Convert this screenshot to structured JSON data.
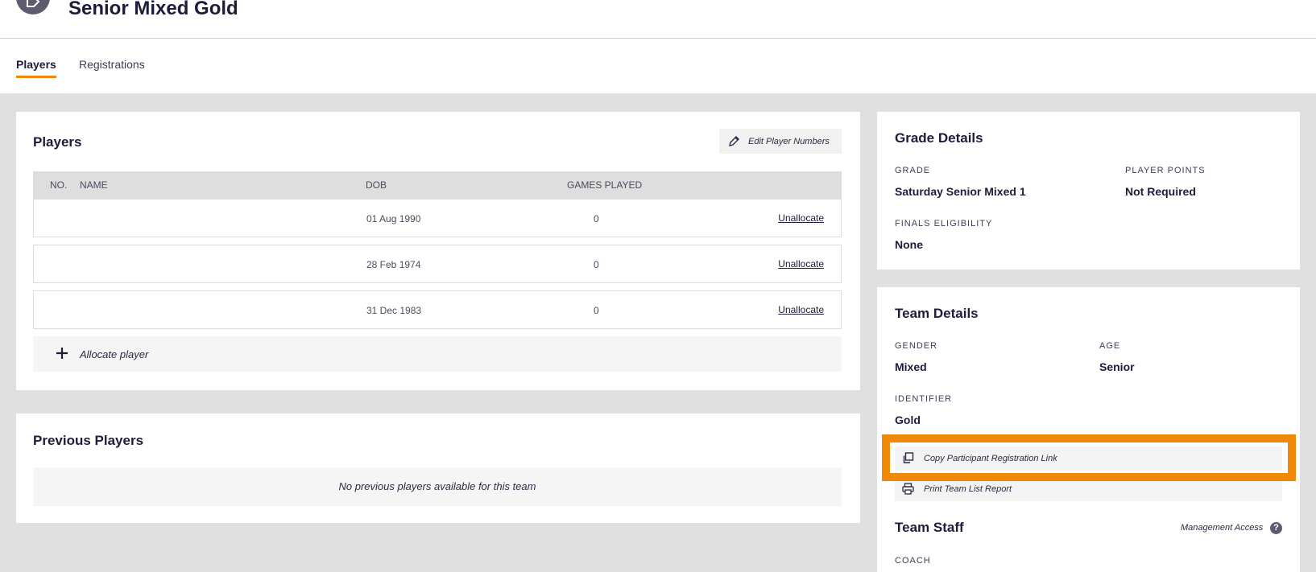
{
  "header": {
    "title": "Senior Mixed Gold",
    "logo_icon": "tag-icon"
  },
  "tabs": [
    {
      "label": "Players",
      "active": true
    },
    {
      "label": "Registrations",
      "active": false
    }
  ],
  "players_card": {
    "title": "Players",
    "edit_button": "Edit Player Numbers",
    "columns": {
      "no": "NO.",
      "name": "NAME",
      "dob": "DOB",
      "games": "GAMES PLAYED"
    },
    "rows": [
      {
        "dob": "01 Aug 1990",
        "games": "0",
        "action": "Unallocate"
      },
      {
        "dob": "28 Feb 1974",
        "games": "0",
        "action": "Unallocate"
      },
      {
        "dob": "31 Dec 1983",
        "games": "0",
        "action": "Unallocate"
      }
    ],
    "allocate_label": "Allocate player"
  },
  "previous_card": {
    "title": "Previous Players",
    "empty_message": "No previous players available for this team"
  },
  "grade_card": {
    "title": "Grade Details",
    "grade_label": "GRADE",
    "grade_value": "Saturday Senior Mixed 1",
    "points_label": "PLAYER POINTS",
    "points_value": "Not Required",
    "finals_label": "FINALS ELIGIBILITY",
    "finals_value": "None"
  },
  "team_card": {
    "title": "Team Details",
    "gender_label": "GENDER",
    "gender_value": "Mixed",
    "age_label": "AGE",
    "age_value": "Senior",
    "identifier_label": "IDENTIFIER",
    "identifier_value": "Gold",
    "copy_link": "Copy Participant Registration Link",
    "print_report": "Print Team List Report",
    "staff_title": "Team Staff",
    "management_access": "Management Access",
    "help_glyph": "?",
    "coach_label": "COACH"
  },
  "colors": {
    "accent": "#f0890a",
    "text": "#1d1d3b",
    "panel": "#ffffff",
    "background": "#e0e0e0"
  }
}
